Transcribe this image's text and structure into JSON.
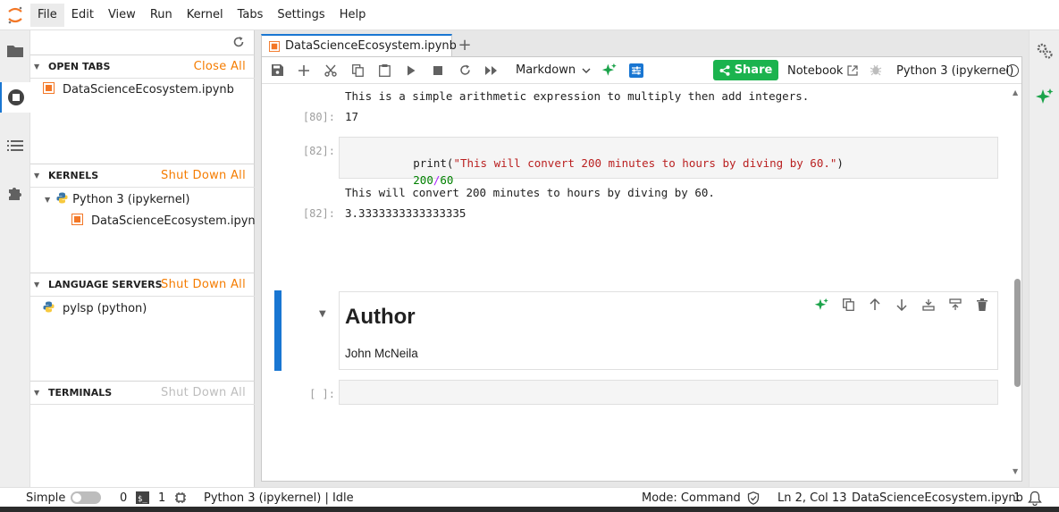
{
  "menu": {
    "items": [
      "File",
      "Edit",
      "View",
      "Run",
      "Kernel",
      "Tabs",
      "Settings",
      "Help"
    ]
  },
  "side_panel": {
    "open_tabs": {
      "title": "OPEN TABS",
      "action": "Close All",
      "items": [
        "DataScienceEcosystem.ipynb"
      ]
    },
    "kernels": {
      "title": "KERNELS",
      "action": "Shut Down All",
      "kernel": "Python 3 (ipykernel)",
      "notebook": "DataScienceEcosystem.ipynb"
    },
    "language_servers": {
      "title": "LANGUAGE SERVERS",
      "action": "Shut Down All",
      "items": [
        "pylsp (python)"
      ]
    },
    "terminals": {
      "title": "TERMINALS",
      "action": "Shut Down All"
    }
  },
  "tab": {
    "label": "DataScienceEcosystem.ipynb",
    "add_label": "+"
  },
  "toolbar": {
    "cell_type": "Markdown",
    "share_label": "Share",
    "notebook_label": "Notebook",
    "kernel_label": "Python 3 (ipykernel)"
  },
  "cells": {
    "prev_output_text": "This is a simple arithmetic expression to multiply then add integers.",
    "c80_prompt": "[80]:",
    "c80_output": "17",
    "c82_prompt": "[82]:",
    "c82_code_print": "print",
    "c82_code_string": "\"This will convert 200 minutes to hours by diving by 60.\"",
    "c82_line2_a": "200",
    "c82_line2_op": "/",
    "c82_line2_b": "60",
    "c82_stdout": "This will convert 200 minutes to hours by diving by 60.",
    "c82_out_prompt": "[82]:",
    "c82_result": "3.3333333333333335",
    "md_heading": "Author",
    "md_text": "John McNeila",
    "empty_prompt": "[ ]:"
  },
  "statusbar": {
    "simple_label": "Simple",
    "terminals_count": "0",
    "kernels_count": "1",
    "kernel_status": "Python 3 (ipykernel) | Idle",
    "mode": "Mode: Command",
    "position": "Ln 2, Col 13",
    "filename": "DataScienceEcosystem.ipynb",
    "notifications": "1"
  },
  "colors": {
    "accent": "#1976d2",
    "share": "#1bb34e",
    "action_orange": "#f57c00"
  }
}
